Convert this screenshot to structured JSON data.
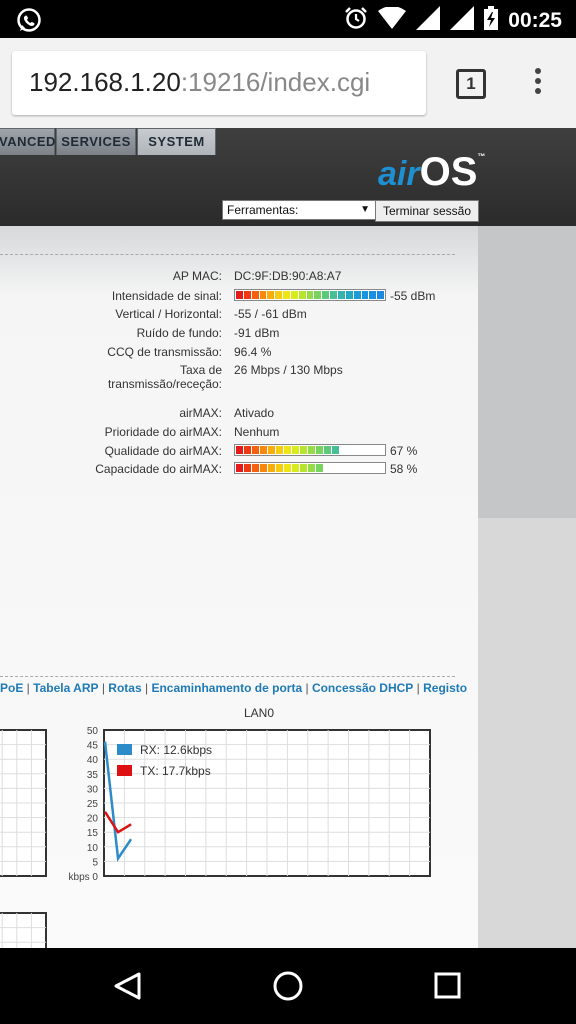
{
  "status_bar": {
    "time": "00:25",
    "icons": [
      "whatsapp-icon",
      "alarm-icon",
      "wifi-icon",
      "signal-icon",
      "signal-icon",
      "battery-icon"
    ]
  },
  "browser": {
    "url_host": "192.168.1.20",
    "url_path": ":19216/index.cgi",
    "tab_count": "1"
  },
  "airos": {
    "logo_air": "air",
    "logo_os": "OS",
    "logo_tm": "™",
    "tabs": [
      "VANCED",
      "SERVICES",
      "SYSTEM"
    ],
    "tools_select": "Ferramentas:",
    "logout_label": "Terminar sessão"
  },
  "status": {
    "ap_mac_label": "AP MAC:",
    "ap_mac": "DC:9F:DB:90:A8:A7",
    "signal_label": "Intensidade de sinal:",
    "signal_value": "-55 dBm",
    "signal_level": 1.0,
    "vh_label": "Vertical / Horizontal:",
    "vh_value": "-55 / -61 dBm",
    "noise_label": "Ruído de fundo:",
    "noise_value": "-91 dBm",
    "ccq_label": "CCQ de transmissão:",
    "ccq_value": "96.4 %",
    "rate_label_1": "Taxa de",
    "rate_label_2": "transmissão/receção:",
    "rate_value": "26 Mbps / 130 Mbps",
    "airmax_label": "airMAX:",
    "airmax_value": "Ativado",
    "priority_label": "Prioridade do airMAX:",
    "priority_value": "Nenhum",
    "quality_label": "Qualidade do airMAX:",
    "quality_value": "67 %",
    "quality_level": 0.67,
    "capacity_label": "Capacidade do airMAX:",
    "capacity_value": "58 %",
    "capacity_level": 0.58
  },
  "links": [
    "PoE",
    "Tabela ARP",
    "Rotas",
    "Encaminhamento de porta",
    "Concessão DHCP",
    "Registo"
  ],
  "chart_data": {
    "type": "line",
    "title": "LAN0",
    "ylabel": "",
    "y_unit_label": "kbps 0",
    "ylim": [
      0,
      50
    ],
    "yticks": [
      "50",
      "45",
      "40",
      "35",
      "30",
      "25",
      "20",
      "15",
      "10",
      "5"
    ],
    "series": [
      {
        "name": "RX: 12.6kbps",
        "color": "#2c8bc9",
        "values": [
          46,
          6,
          12.6
        ]
      },
      {
        "name": "TX: 17.7kbps",
        "color": "#dd1111",
        "values": [
          22,
          15,
          17.7
        ]
      }
    ],
    "legend": "top-left"
  }
}
